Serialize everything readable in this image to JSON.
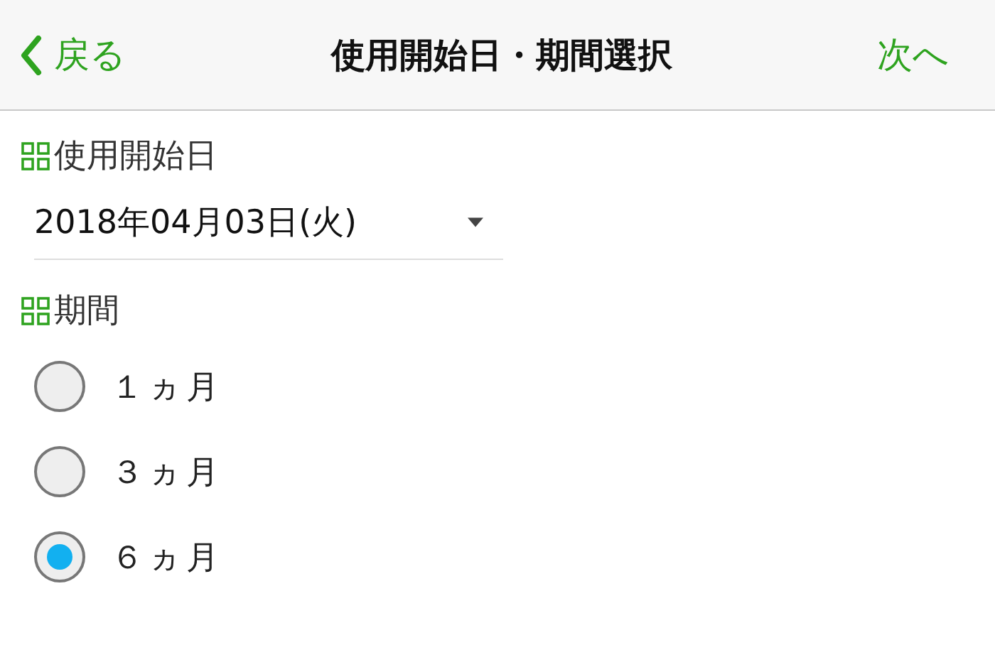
{
  "nav_bar": {
    "back": "戻る",
    "title": "使用開始日・期間選択",
    "next": "次へ"
  },
  "start_date": {
    "label": "使用開始日",
    "value": "2018年04月03日(火)"
  },
  "period": {
    "label": "期間",
    "options": [
      {
        "label": "１ヵ月",
        "selected": false
      },
      {
        "label": "３ヵ月",
        "selected": false
      },
      {
        "label": "６ヵ月",
        "selected": true
      }
    ]
  }
}
